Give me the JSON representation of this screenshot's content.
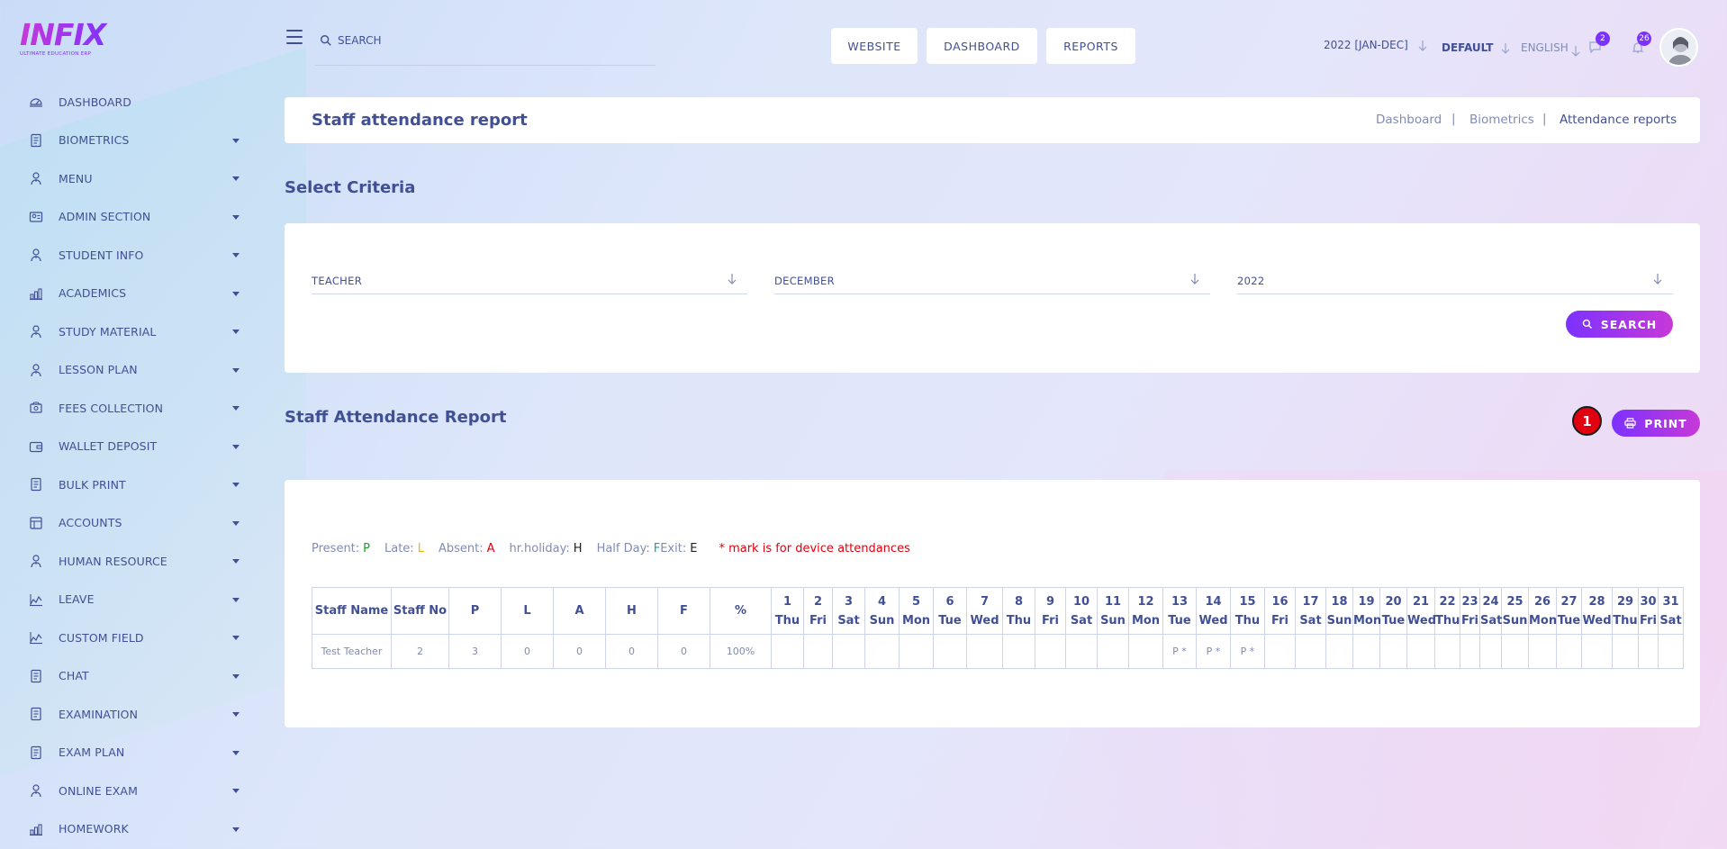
{
  "logo": {
    "main": "INFIX",
    "sub": "ULTIMATE EDUCATION ERP"
  },
  "sidebar": {
    "items": [
      {
        "label": "DASHBOARD",
        "icon": "dashboard-icon",
        "caret": false
      },
      {
        "label": "BIOMETRICS",
        "icon": "document-icon",
        "caret": true
      },
      {
        "label": "MENU",
        "icon": "user-icon",
        "caret": true
      },
      {
        "label": "ADMIN SECTION",
        "icon": "admin-icon",
        "caret": true
      },
      {
        "label": "STUDENT INFO",
        "icon": "user-icon",
        "caret": true
      },
      {
        "label": "ACADEMICS",
        "icon": "academics-icon",
        "caret": true
      },
      {
        "label": "STUDY MATERIAL",
        "icon": "user-icon",
        "caret": true
      },
      {
        "label": "LESSON PLAN",
        "icon": "user-icon",
        "caret": true
      },
      {
        "label": "FEES COLLECTION",
        "icon": "fees-icon",
        "caret": true
      },
      {
        "label": "WALLET DEPOSIT",
        "icon": "wallet-icon",
        "caret": true
      },
      {
        "label": "BULK PRINT",
        "icon": "document-icon",
        "caret": true
      },
      {
        "label": "ACCOUNTS",
        "icon": "accounts-icon",
        "caret": true
      },
      {
        "label": "HUMAN RESOURCE",
        "icon": "user-icon",
        "caret": true
      },
      {
        "label": "LEAVE",
        "icon": "leave-icon",
        "caret": true
      },
      {
        "label": "CUSTOM FIELD",
        "icon": "leave-icon",
        "caret": true
      },
      {
        "label": "CHAT",
        "icon": "document-icon",
        "caret": true
      },
      {
        "label": "EXAMINATION",
        "icon": "document-icon",
        "caret": true
      },
      {
        "label": "EXAM PLAN",
        "icon": "document-icon",
        "caret": true
      },
      {
        "label": "ONLINE EXAM",
        "icon": "user-icon",
        "caret": true
      },
      {
        "label": "HOMEWORK",
        "icon": "academics-icon",
        "caret": true
      }
    ]
  },
  "header": {
    "search_placeholder": "SEARCH",
    "buttons": {
      "website": "WEBSITE",
      "dashboard": "DASHBOARD",
      "reports": "REPORTS"
    },
    "session": "2022 [JAN-DEC]",
    "style": "DEFAULT",
    "language": "ENGLISH",
    "chat_badge": "2",
    "notification_badge": "26"
  },
  "title_bar": {
    "title": "Staff attendance report",
    "breadcrumb": [
      "Dashboard",
      "Biometrics",
      "Attendance reports"
    ],
    "separator": "|"
  },
  "criteria": {
    "title": "Select Criteria",
    "role": "TEACHER",
    "month": "DECEMBER",
    "year": "2022",
    "search_button": "SEARCH"
  },
  "report": {
    "title": "Staff Attendance Report",
    "counter": "1",
    "print_button": "PRINT",
    "legend": {
      "present_label": "Present:",
      "present_code": "P",
      "late_label": "Late:",
      "late_code": "L",
      "absent_label": "Absent:",
      "absent_code": "A",
      "holiday_label": "hr.holiday:",
      "holiday_code": "H",
      "halfday_label": "Half Day:",
      "halfday_code": "F",
      "exit_label": "Exit:",
      "exit_code": "E",
      "note": "* mark is for device attendances"
    },
    "columns": [
      "Staff Name",
      "Staff No",
      "P",
      "L",
      "A",
      "H",
      "F",
      "%"
    ],
    "days": [
      {
        "n": "1",
        "d": "Thu"
      },
      {
        "n": "2",
        "d": "Fri"
      },
      {
        "n": "3",
        "d": "Sat"
      },
      {
        "n": "4",
        "d": "Sun"
      },
      {
        "n": "5",
        "d": "Mon"
      },
      {
        "n": "6",
        "d": "Tue"
      },
      {
        "n": "7",
        "d": "Wed"
      },
      {
        "n": "8",
        "d": "Thu"
      },
      {
        "n": "9",
        "d": "Fri"
      },
      {
        "n": "10",
        "d": "Sat"
      },
      {
        "n": "11",
        "d": "Sun"
      },
      {
        "n": "12",
        "d": "Mon"
      },
      {
        "n": "13",
        "d": "Tue"
      },
      {
        "n": "14",
        "d": "Wed"
      },
      {
        "n": "15",
        "d": "Thu"
      },
      {
        "n": "16",
        "d": "Fri"
      },
      {
        "n": "17",
        "d": "Sat"
      },
      {
        "n": "18",
        "d": "Sun"
      },
      {
        "n": "19",
        "d": "Mon"
      },
      {
        "n": "20",
        "d": "Tue"
      },
      {
        "n": "21",
        "d": "Wed"
      },
      {
        "n": "22",
        "d": "Thu"
      },
      {
        "n": "23",
        "d": "Fri"
      },
      {
        "n": "24",
        "d": "Sat"
      },
      {
        "n": "25",
        "d": "Sun"
      },
      {
        "n": "26",
        "d": "Mon"
      },
      {
        "n": "27",
        "d": "Tue"
      },
      {
        "n": "28",
        "d": "Wed"
      },
      {
        "n": "29",
        "d": "Thu"
      },
      {
        "n": "30",
        "d": "Fri"
      },
      {
        "n": "31",
        "d": "Sat"
      }
    ],
    "rows": [
      {
        "name": "Test Teacher",
        "staff_no": "2",
        "p": "3",
        "l": "0",
        "a": "0",
        "h": "0",
        "f": "0",
        "pct": "100%",
        "marks": [
          "",
          "",
          "",
          "",
          "",
          "",
          "",
          "",
          "",
          "",
          "",
          "",
          "P *",
          "P *",
          "P *",
          "",
          "",
          "",
          "",
          "",
          "",
          "",
          "",
          "",
          "",
          "",
          "",
          "",
          "",
          "",
          ""
        ]
      }
    ]
  },
  "colors": {
    "primary": "#415094",
    "accent": "#7c32ff",
    "accent2": "#c738d8",
    "present": "#1e9e1e",
    "late": "#e5b80b",
    "absent": "#e1000f",
    "note": "#e1000f",
    "halfday": "#16a3b8"
  }
}
